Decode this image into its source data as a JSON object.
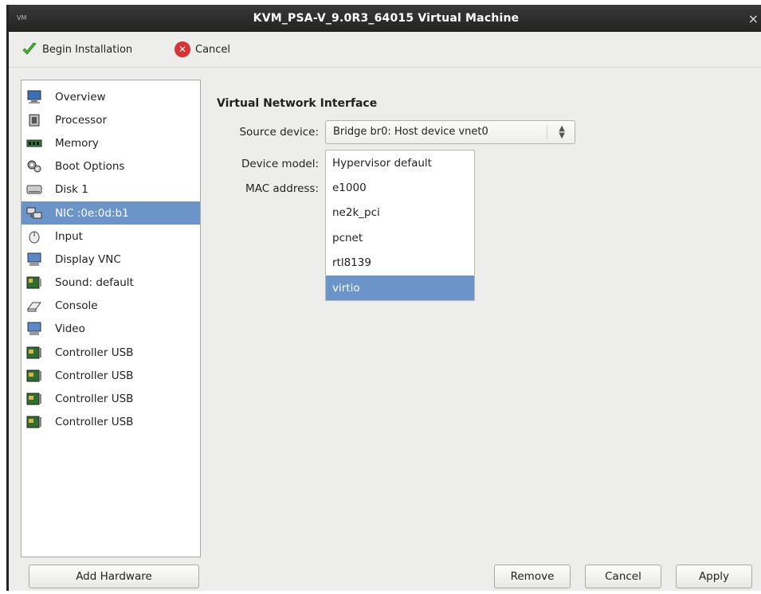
{
  "window": {
    "title": "KVM_PSA-V_9.0R3_64015 Virtual Machine",
    "app_icon_text": "VM",
    "close_glyph": "×"
  },
  "toolbar": {
    "begin_label": "Begin Installation",
    "begin_icon": "check-icon",
    "cancel_label": "Cancel",
    "cancel_icon": "cancel-x-icon"
  },
  "sidebar": {
    "items": [
      {
        "label": "Overview",
        "icon": "monitor-icon"
      },
      {
        "label": "Processor",
        "icon": "cpu-icon"
      },
      {
        "label": "Memory",
        "icon": "memory-icon"
      },
      {
        "label": "Boot Options",
        "icon": "gears-icon"
      },
      {
        "label": "Disk 1",
        "icon": "disk-icon"
      },
      {
        "label": "NIC :0e:0d:b1",
        "icon": "network-icon",
        "selected": true
      },
      {
        "label": "Input",
        "icon": "mouse-icon"
      },
      {
        "label": "Display VNC",
        "icon": "display-icon"
      },
      {
        "label": "Sound: default",
        "icon": "sound-card-icon"
      },
      {
        "label": "Console",
        "icon": "console-icon"
      },
      {
        "label": "Video",
        "icon": "video-icon"
      },
      {
        "label": "Controller USB",
        "icon": "controller-card-icon"
      },
      {
        "label": "Controller USB",
        "icon": "controller-card-icon"
      },
      {
        "label": "Controller USB",
        "icon": "controller-card-icon"
      },
      {
        "label": "Controller USB",
        "icon": "controller-card-icon"
      }
    ],
    "add_hardware_label": "Add Hardware"
  },
  "main": {
    "section_title": "Virtual Network Interface",
    "source_device_label": "Source device:",
    "source_device_value": "Bridge br0: Host device vnet0",
    "device_model_label": "Device model:",
    "mac_address_label": "MAC address:",
    "device_model_options": [
      "Hypervisor default",
      "e1000",
      "ne2k_pci",
      "pcnet",
      "rtl8139",
      "virtio"
    ],
    "device_model_selected": "virtio"
  },
  "footer": {
    "remove_label": "Remove",
    "cancel_label": "Cancel",
    "apply_label": "Apply"
  },
  "colors": {
    "selection": "#6b95c8",
    "titlebar": "#2a2a2a",
    "cancel_icon": "#d93232",
    "check_icon": "#4caf36"
  }
}
